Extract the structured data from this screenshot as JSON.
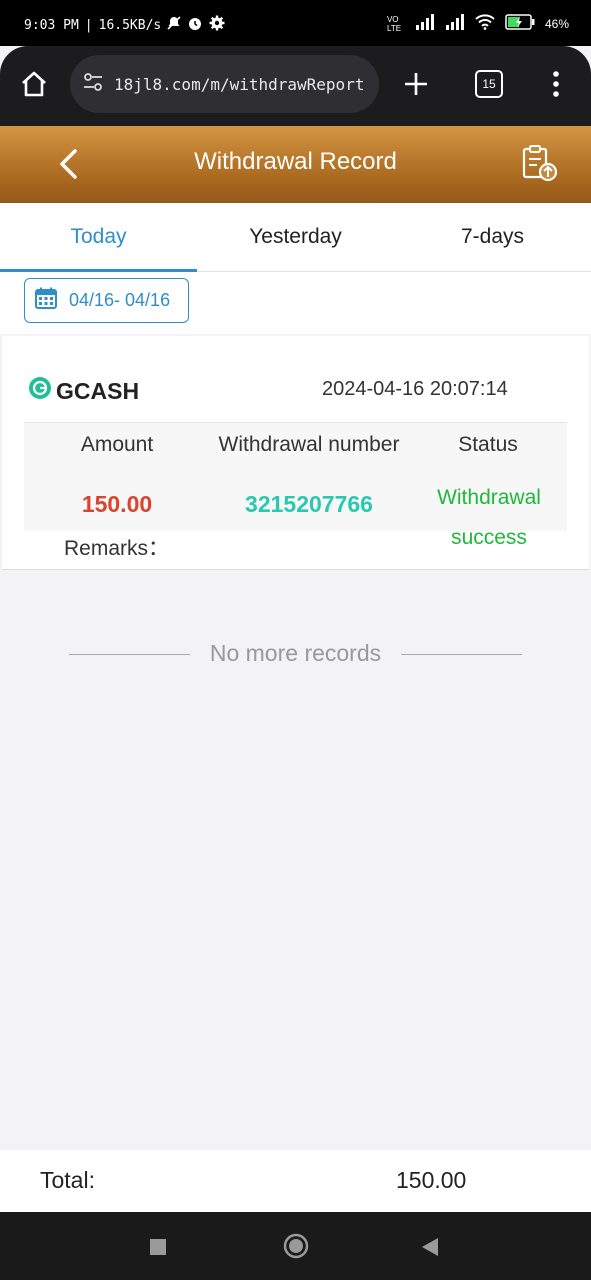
{
  "status_bar": {
    "time": "9:03 PM",
    "speed": "16.5KB/s",
    "volte": "VO LTE",
    "battery": "46%"
  },
  "browser": {
    "url": "18jl8.com/m/withdrawReport?",
    "tab_count": "15"
  },
  "header": {
    "title": "Withdrawal Record"
  },
  "tabs": [
    {
      "label": "Today",
      "active": true
    },
    {
      "label": "Yesterday",
      "active": false
    },
    {
      "label": "7-days",
      "active": false
    }
  ],
  "date_range": "04/16- 04/16",
  "record": {
    "method": "GCASH",
    "datetime": "2024-04-16 20:07:14",
    "headers": {
      "amount": "Amount",
      "number": "Withdrawal number",
      "status": "Status"
    },
    "amount": "150.00",
    "number": "3215207766",
    "status_line1": "Withdrawal",
    "status_line2": "success",
    "remarks_label": "Remarks："
  },
  "no_more": "No more records",
  "total": {
    "label": "Total:",
    "value": "150.00"
  },
  "colors": {
    "accent": "#2f8ec9",
    "amount": "#d9452f",
    "number": "#2bc8b0",
    "success": "#1fb83a",
    "header_gold": "#b0742a"
  }
}
